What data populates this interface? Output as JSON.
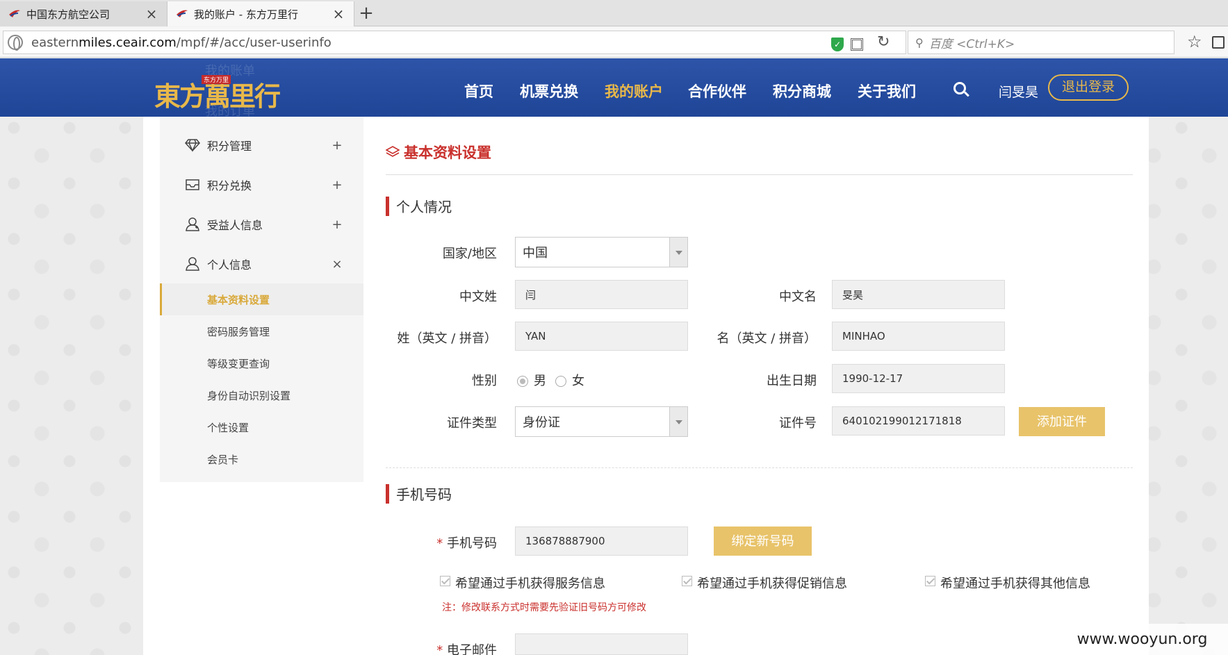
{
  "browser": {
    "tabs": [
      {
        "label": "中国东方航空公司",
        "active": false
      },
      {
        "label": "我的账户 - 东方万里行",
        "active": true
      }
    ],
    "url_prefix": "eastern",
    "url_domain": "miles.ceair.com",
    "url_path": "/mpf/#/acc/user-userinfo",
    "search_placeholder": "百度 <Ctrl+K>"
  },
  "header": {
    "logo_text": "東方萬里行",
    "logo_badge": "东方万里",
    "nav": [
      {
        "label": "首页",
        "active": false
      },
      {
        "label": "机票兑换",
        "active": false
      },
      {
        "label": "我的账户",
        "active": true
      },
      {
        "label": "合作伙伴",
        "active": false
      },
      {
        "label": "积分商城",
        "active": false
      },
      {
        "label": "关于我们",
        "active": false
      }
    ],
    "username": "闫旻昊",
    "logout_label": "退出登录",
    "ghost_items": [
      "我的账单",
      "我的订单"
    ]
  },
  "sidebar": {
    "items": [
      {
        "label": "积分管理",
        "expander": "+"
      },
      {
        "label": "积分兑换",
        "expander": "+"
      },
      {
        "label": "受益人信息",
        "expander": "+"
      },
      {
        "label": "个人信息",
        "expander": "×"
      }
    ],
    "subitems": [
      {
        "label": "基本资料设置",
        "active": true
      },
      {
        "label": "密码服务管理",
        "active": false
      },
      {
        "label": "等级变更查询",
        "active": false
      },
      {
        "label": "身份自动识别设置",
        "active": false
      },
      {
        "label": "个性设置",
        "active": false
      },
      {
        "label": "会员卡",
        "active": false
      }
    ]
  },
  "main": {
    "section_title": "基本资料设置",
    "personal": {
      "title": "个人情况",
      "country_label": "国家/地区",
      "country_value": "中国",
      "cn_surname_label": "中文姓",
      "cn_surname_value": "闫",
      "cn_name_label": "中文名",
      "cn_name_value": "旻昊",
      "en_surname_label": "姓（英文 / 拼音）",
      "en_surname_value": "YAN",
      "en_name_label": "名（英文 / 拼音）",
      "en_name_value": "MINHAO",
      "gender_label": "性别",
      "gender_male": "男",
      "gender_female": "女",
      "gender_selected": "男",
      "birth_label": "出生日期",
      "birth_value": "1990-12-17",
      "id_type_label": "证件类型",
      "id_type_value": "身份证",
      "id_no_label": "证件号",
      "id_no_value": "640102199012171818",
      "add_id_label": "添加证件"
    },
    "mobile": {
      "title": "手机号码",
      "required_mark": "*",
      "phone_label": "手机号码",
      "phone_value": "136878887900",
      "bind_label": "绑定新号码",
      "check_service": "希望通过手机获得服务信息",
      "check_promo": "希望通过手机获得促销信息",
      "check_other": "希望通过手机获得其他信息",
      "note": "注：修改联系方式时需要先验证旧号码方可修改"
    },
    "email": {
      "required_mark": "*",
      "label": "电子邮件"
    }
  },
  "watermark": "www.wooyun.org",
  "colors": {
    "header_blue": "#2d54a8",
    "accent_gold": "#e8b84a",
    "accent_red": "#c9312d"
  }
}
